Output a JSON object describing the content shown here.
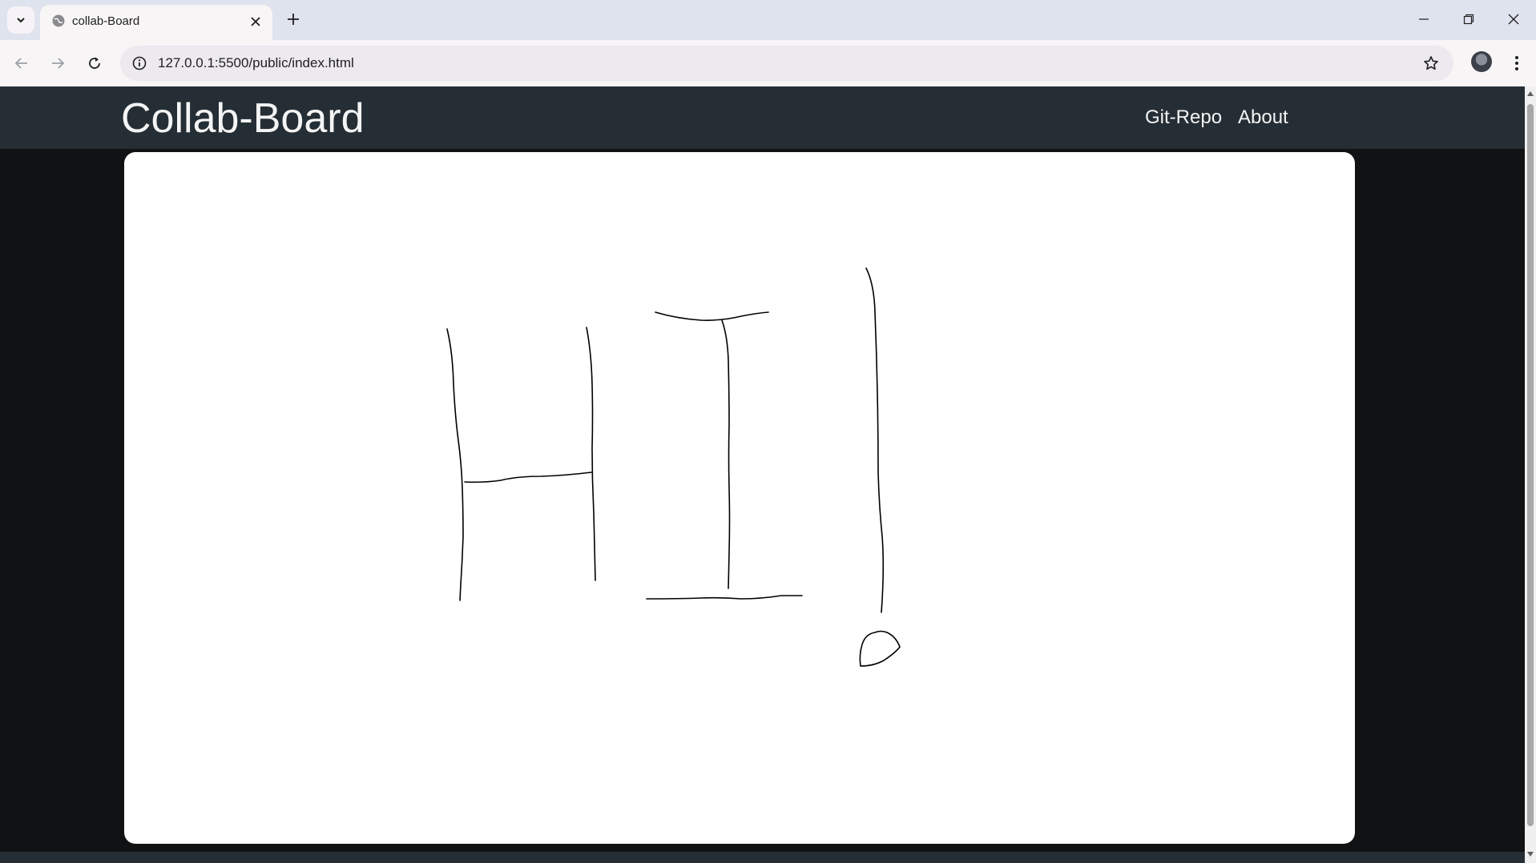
{
  "browser": {
    "tab": {
      "title": "collab-Board"
    },
    "address": {
      "url": "127.0.0.1:5500/public/index.html"
    }
  },
  "icons": {
    "tab_list": "chevron-down-icon",
    "favicon": "globe-icon",
    "tab_close": "close-icon",
    "new_tab": "plus-icon",
    "back": "arrow-left-icon",
    "forward": "arrow-right-icon",
    "reload": "reload-icon",
    "site_info": "info-icon",
    "bookmark": "star-icon",
    "menu": "kebab-menu-icon",
    "minimize": "minimize-icon",
    "maximize": "restore-icon",
    "close": "close-icon"
  },
  "navbar": {
    "brand": "Collab-Board",
    "links": [
      "Git-Repo",
      "About"
    ]
  },
  "colors": {
    "navbar_bg": "#252e35",
    "page_bg": "#111213",
    "board_bg": "#ffffff",
    "ink": "#000000"
  }
}
